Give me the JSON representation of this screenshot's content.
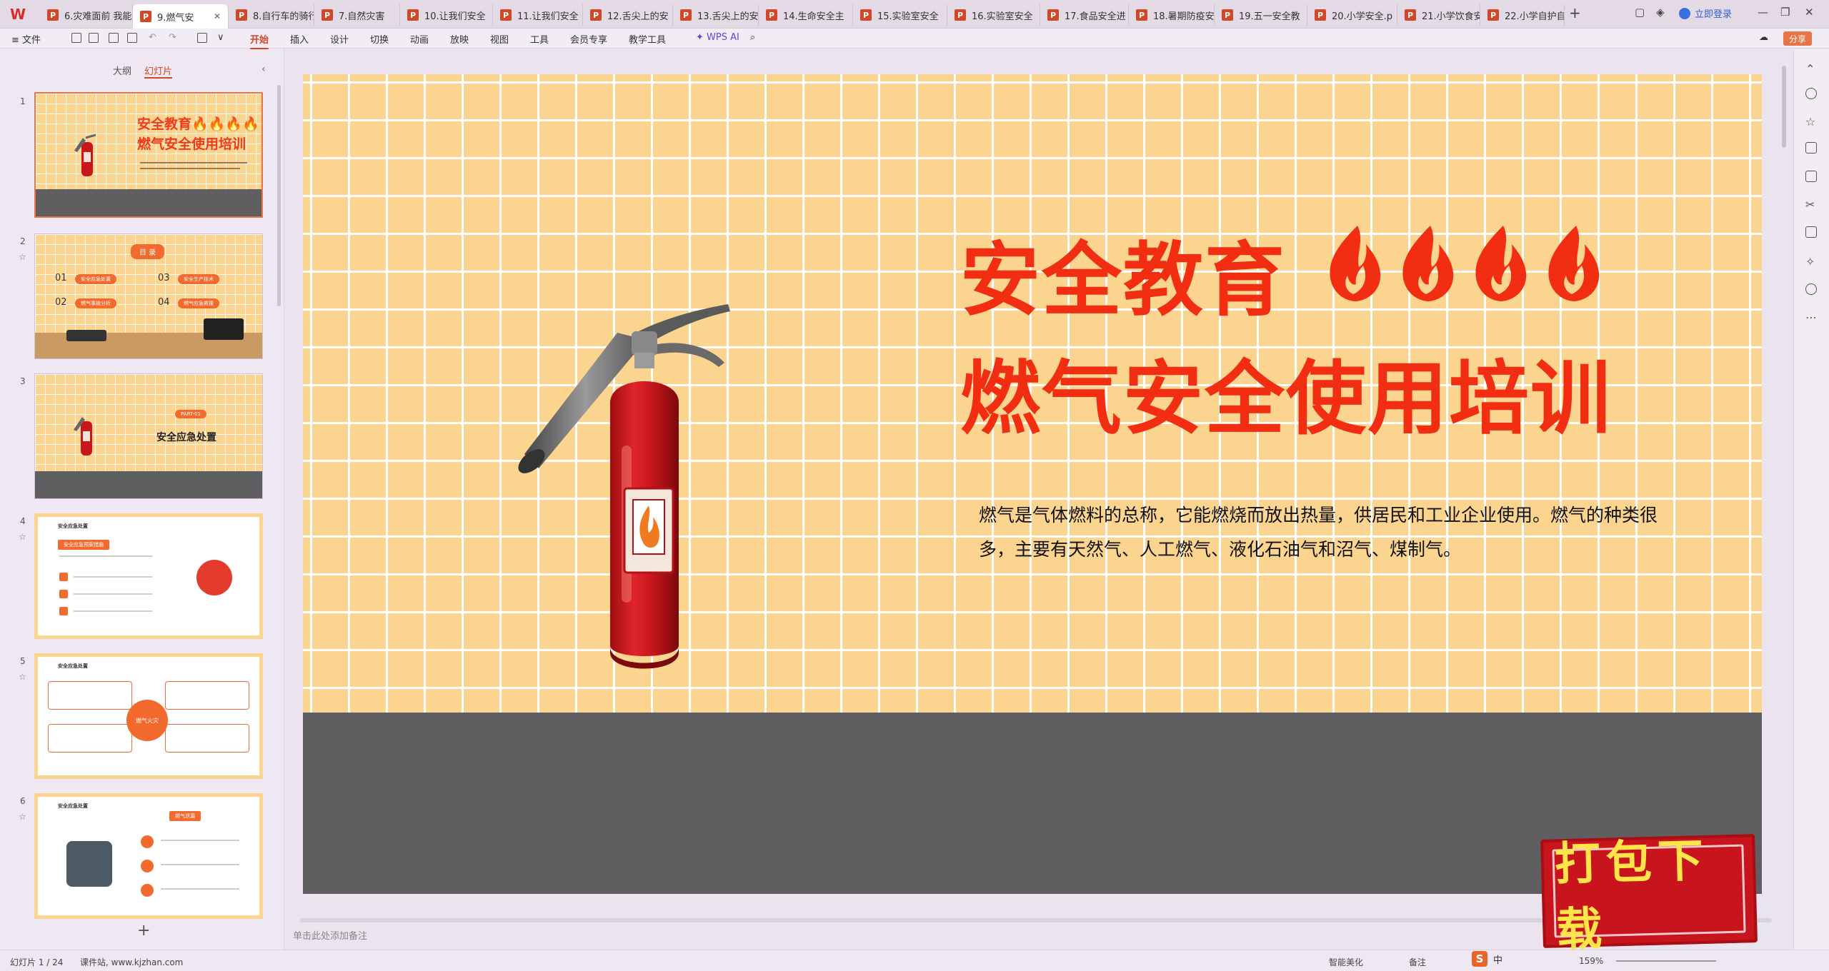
{
  "app": {
    "logo_text": "W",
    "accent": "#d24726"
  },
  "tabs": [
    {
      "label": "6.灾难面前 我能",
      "active": false
    },
    {
      "label": "9.燃气安",
      "active": true
    },
    {
      "label": "8.自行车的骑行",
      "active": false
    },
    {
      "label": "7.自然灾害",
      "active": false
    },
    {
      "label": "10.让我们安全",
      "active": false
    },
    {
      "label": "11.让我们安全",
      "active": false
    },
    {
      "label": "12.舌尖上的安",
      "active": false
    },
    {
      "label": "13.舌尖上的安",
      "active": false
    },
    {
      "label": "14.生命安全主",
      "active": false
    },
    {
      "label": "15.实验室安全",
      "active": false
    },
    {
      "label": "16.实验室安全",
      "active": false
    },
    {
      "label": "17.食品安全进",
      "active": false
    },
    {
      "label": "18.暑期防疫安",
      "active": false
    },
    {
      "label": "19.五一安全教",
      "active": false
    },
    {
      "label": "20.小学安全.p",
      "active": false
    },
    {
      "label": "21.小学饮食安",
      "active": false
    },
    {
      "label": "22.小学自护自",
      "active": false
    }
  ],
  "titlebar": {
    "login_label": "立即登录"
  },
  "menubar": {
    "file_label": "≡ 文件",
    "items": [
      "开始",
      "插入",
      "设计",
      "切换",
      "动画",
      "放映",
      "视图",
      "工具",
      "会员专享",
      "教学工具"
    ],
    "wps_ai_label": "WPS AI",
    "share_label": "分享"
  },
  "left_panel": {
    "tab_outline": "大纲",
    "tab_slides": "幻灯片",
    "slides": [
      {
        "num": "1",
        "title_line1": "安全教育🔥🔥🔥🔥",
        "title_line2": "燃气安全使用培训"
      },
      {
        "num": "2",
        "heading": "目 录",
        "items": [
          {
            "no": "01",
            "label": "安全应急处置"
          },
          {
            "no": "03",
            "label": "安全生产技术"
          },
          {
            "no": "02",
            "label": "燃气事故分析"
          },
          {
            "no": "04",
            "label": "燃气应急救援"
          }
        ]
      },
      {
        "num": "3",
        "part": "PART-01",
        "title": "安全应急处置"
      },
      {
        "num": "4",
        "header": "安全应急处置",
        "sub": "安全应急预案措施"
      },
      {
        "num": "5",
        "header": "安全应急处置",
        "center": "燃气火灾"
      },
      {
        "num": "6",
        "header": "安全应急处置",
        "sub": "燃气泄漏"
      }
    ],
    "add_label": "+"
  },
  "slide": {
    "title_line1": "安全教育",
    "title_line2": "燃气安全使用培训",
    "description": "燃气是气体燃料的总称，它能燃烧而放出热量，供居民和工业企业使用。燃气的种类很多，主要有天然气、人工燃气、液化石油气和沼气、煤制气。",
    "bg_color": "#fbd490",
    "floor_color": "#5f5f61",
    "title_color": "#f22e12"
  },
  "notes_placeholder": "单击此处添加备注",
  "status": {
    "slide_counter": "幻灯片 1 / 24",
    "site": "课件站, www.kjzhan.com",
    "beautify": "智能美化",
    "notes": "备注",
    "zoom": "159%"
  },
  "ime": {
    "logo": "S",
    "lang": "中"
  },
  "watermark": {
    "text": "打包下载"
  }
}
